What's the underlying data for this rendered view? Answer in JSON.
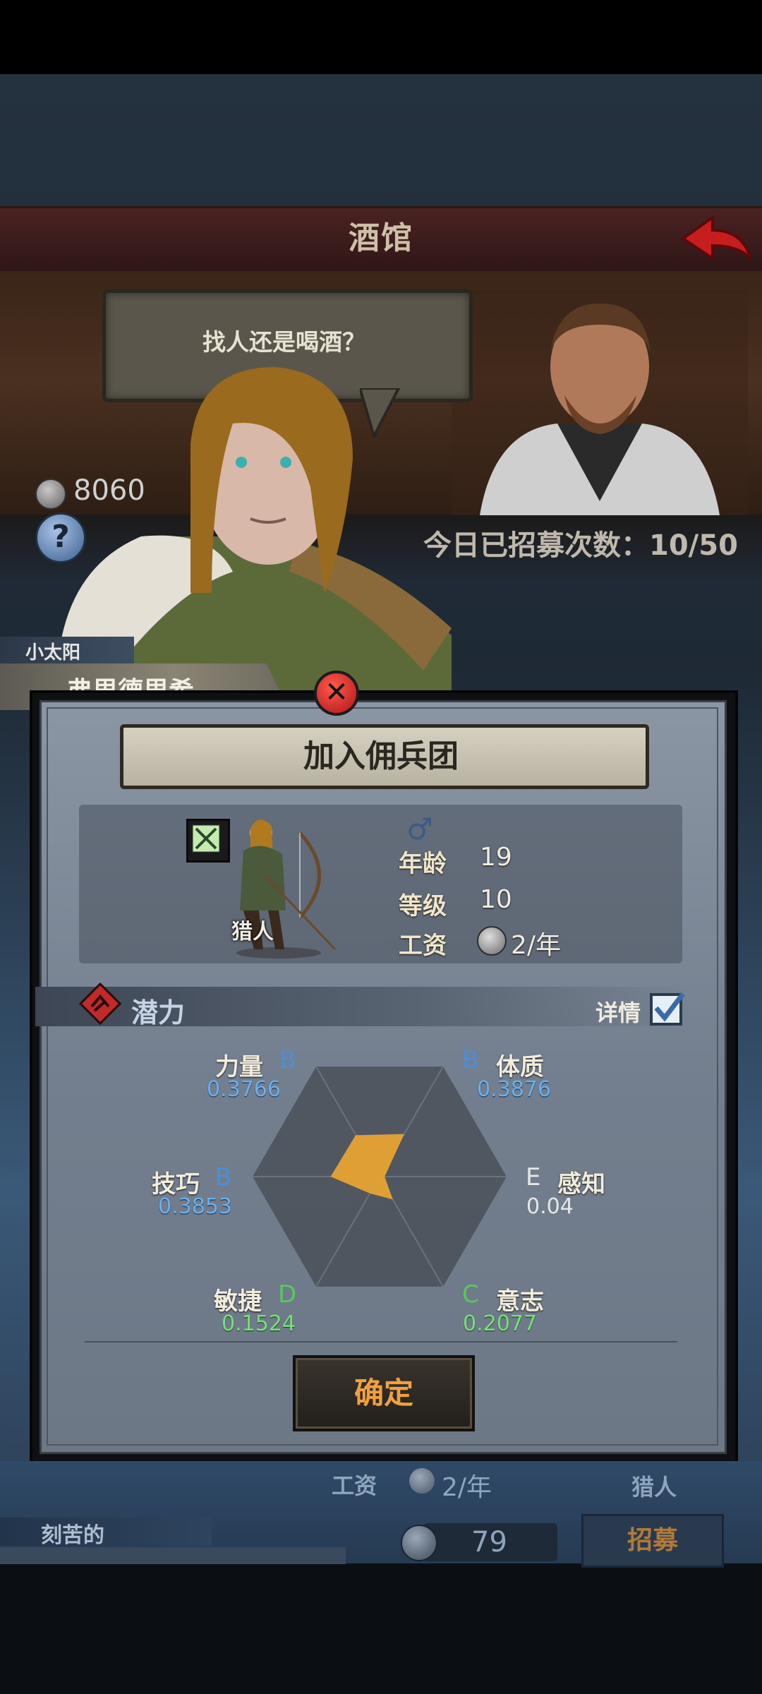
{
  "tavern": {
    "title": "酒馆",
    "speech": "找人还是喝酒？",
    "silver": "8060",
    "recruit_count": "今日已招募次数：10/50"
  },
  "mercenary": {
    "title": "小太阳",
    "name": "弗里德里希",
    "class": "猎人",
    "gender_icon": "male-icon",
    "stats": {
      "age_label": "年龄",
      "age_value": "19",
      "level_label": "等级",
      "level_value": "10",
      "wage_label": "工资",
      "wage_value": "2/年"
    }
  },
  "dialog": {
    "banner": "加入佣兵团",
    "potential_label": "潜力",
    "detail_label": "详情",
    "confirm_label": "确定"
  },
  "attributes": {
    "strength": {
      "name": "力量",
      "grade": "B",
      "value": "0.3766"
    },
    "constitution": {
      "name": "体质",
      "grade": "B",
      "value": "0.3876"
    },
    "skill": {
      "name": "技巧",
      "grade": "B",
      "value": "0.3853"
    },
    "perception": {
      "name": "感知",
      "grade": "E",
      "value": "0.04"
    },
    "agility": {
      "name": "敏捷",
      "grade": "D",
      "value": "0.1524"
    },
    "will": {
      "name": "意志",
      "grade": "C",
      "value": "0.2077"
    }
  },
  "background_card": {
    "wage_label": "工资",
    "wage_value": "2/年",
    "class": "猎人",
    "trait": "刻苦的",
    "price": "79",
    "recruit_label": "招募"
  },
  "colors": {
    "radar_fill": "#e6a332",
    "grade_b": "#4a8fd8",
    "grade_green": "#5ac85a",
    "confirm_text": "#f0a040"
  }
}
